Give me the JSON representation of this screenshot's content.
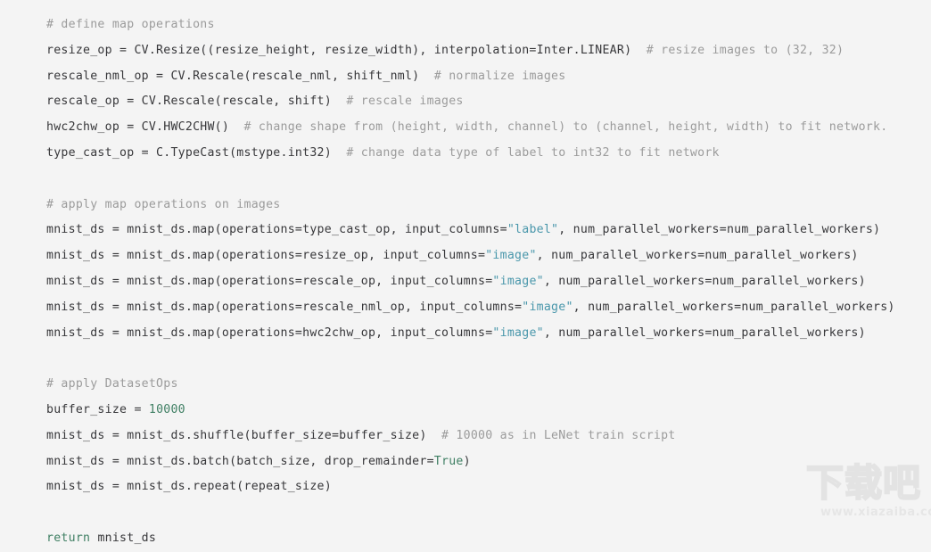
{
  "page": {
    "background_color": "#f4f4f4",
    "text_color": "#37373a",
    "comment_color": "#9b9b9b",
    "string_color": "#4a97ab",
    "number_color": "#3f7f63",
    "keyword_color": "#3f7f63"
  },
  "code": {
    "language": "python",
    "lines": [
      {
        "id": "line-1",
        "type": "comment",
        "text": "# define map operations"
      },
      {
        "id": "line-2",
        "type": "code",
        "text": "resize_op = CV.Resize((resize_height, resize_width), interpolation=Inter.LINEAR)",
        "comment": "  # resize images to (32, 32)"
      },
      {
        "id": "line-3",
        "type": "code",
        "text": "rescale_nml_op = CV.Rescale(rescale_nml, shift_nml)",
        "comment": "  # normalize images"
      },
      {
        "id": "line-4",
        "type": "code",
        "text": "rescale_op = CV.Rescale(rescale, shift)",
        "comment": "  # rescale images"
      },
      {
        "id": "line-5",
        "type": "code",
        "text": "hwc2chw_op = CV.HWC2CHW()",
        "comment": "  # change shape from (height, width, channel) to (channel, height, width) to fit network."
      },
      {
        "id": "line-6",
        "type": "code",
        "text": "type_cast_op = C.TypeCast(mstype.int32)",
        "comment": "  # change data type of label to int32 to fit network"
      },
      {
        "id": "line-7",
        "type": "blank",
        "text": ""
      },
      {
        "id": "line-8",
        "type": "comment",
        "text": "# apply map operations on images"
      },
      {
        "id": "line-9",
        "type": "code-str",
        "pre": "mnist_ds = mnist_ds.map(operations=type_cast_op, input_columns=",
        "str": "\"label\"",
        "post": ", num_parallel_workers=num_parallel_workers)"
      },
      {
        "id": "line-10",
        "type": "code-str",
        "pre": "mnist_ds = mnist_ds.map(operations=resize_op, input_columns=",
        "str": "\"image\"",
        "post": ", num_parallel_workers=num_parallel_workers)"
      },
      {
        "id": "line-11",
        "type": "code-str",
        "pre": "mnist_ds = mnist_ds.map(operations=rescale_op, input_columns=",
        "str": "\"image\"",
        "post": ", num_parallel_workers=num_parallel_workers)"
      },
      {
        "id": "line-12",
        "type": "code-str",
        "pre": "mnist_ds = mnist_ds.map(operations=rescale_nml_op, input_columns=",
        "str": "\"image\"",
        "post": ", num_parallel_workers=num_parallel_workers)"
      },
      {
        "id": "line-13",
        "type": "code-str",
        "pre": "mnist_ds = mnist_ds.map(operations=hwc2chw_op, input_columns=",
        "str": "\"image\"",
        "post": ", num_parallel_workers=num_parallel_workers)"
      },
      {
        "id": "line-14",
        "type": "blank",
        "text": ""
      },
      {
        "id": "line-15",
        "type": "comment",
        "text": "# apply DatasetOps"
      },
      {
        "id": "line-16",
        "type": "code-num",
        "pre": "buffer_size = ",
        "num": "10000",
        "post": ""
      },
      {
        "id": "line-17",
        "type": "code",
        "text": "mnist_ds = mnist_ds.shuffle(buffer_size=buffer_size)",
        "comment": "  # 10000 as in LeNet train script"
      },
      {
        "id": "line-18",
        "type": "code-bool",
        "pre": "mnist_ds = mnist_ds.batch(batch_size, drop_remainder=",
        "bool": "True",
        "post": ")"
      },
      {
        "id": "line-19",
        "type": "code",
        "text": "mnist_ds = mnist_ds.repeat(repeat_size)",
        "comment": ""
      },
      {
        "id": "line-20",
        "type": "blank",
        "text": ""
      },
      {
        "id": "line-21",
        "type": "code-kw",
        "kw": "return",
        "post": " mnist_ds"
      }
    ]
  },
  "watermark": {
    "logo_text": "下载吧",
    "url_text": "www.xiazaiba.com"
  }
}
